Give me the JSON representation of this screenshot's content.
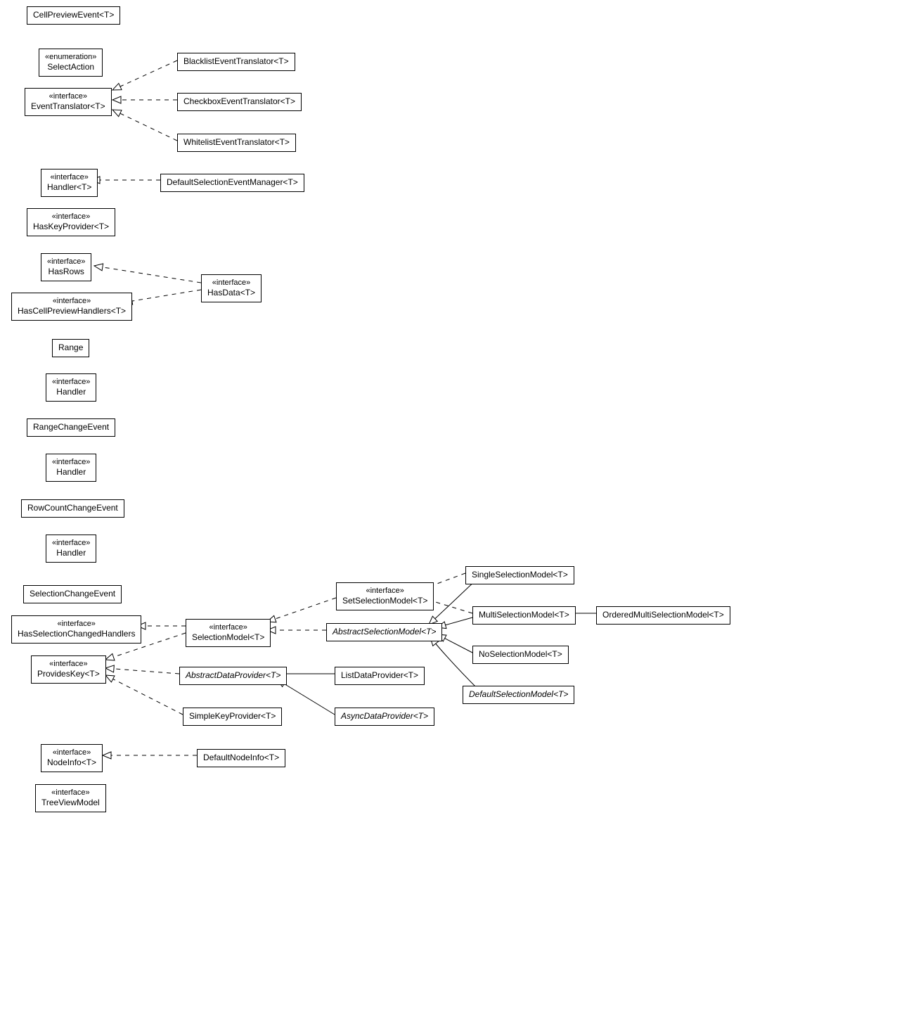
{
  "stereotypes": {
    "interface": "«interface»",
    "enumeration": "«enumeration»"
  },
  "nodes": {
    "CellPreviewEvent": "CellPreviewEvent<T>",
    "SelectAction": "SelectAction",
    "EventTranslator": "EventTranslator<T>",
    "BlacklistEventTranslator": "BlacklistEventTranslator<T>",
    "CheckboxEventTranslator": "CheckboxEventTranslator<T>",
    "WhitelistEventTranslator": "WhitelistEventTranslator<T>",
    "HandlerT": "Handler<T>",
    "DefaultSelectionEventManager": "DefaultSelectionEventManager<T>",
    "HasKeyProvider": "HasKeyProvider<T>",
    "HasRows": "HasRows",
    "HasData": "HasData<T>",
    "HasCellPreviewHandlers": "HasCellPreviewHandlers<T>",
    "Range": "Range",
    "Handler1": "Handler",
    "RangeChangeEvent": "RangeChangeEvent",
    "Handler2": "Handler",
    "RowCountChangeEvent": "RowCountChangeEvent",
    "Handler3": "Handler",
    "SelectionChangeEvent": "SelectionChangeEvent",
    "HasSelectionChangedHandlers": "HasSelectionChangedHandlers",
    "ProvidesKey": "ProvidesKey<T>",
    "SelectionModel": "SelectionModel<T>",
    "SetSelectionModel": "SetSelectionModel<T>",
    "AbstractSelectionModel": "AbstractSelectionModel<T>",
    "SingleSelectionModel": "SingleSelectionModel<T>",
    "MultiSelectionModel": "MultiSelectionModel<T>",
    "OrderedMultiSelectionModel": "OrderedMultiSelectionModel<T>",
    "NoSelectionModel": "NoSelectionModel<T>",
    "DefaultSelectionModel": "DefaultSelectionModel<T>",
    "AbstractDataProvider": "AbstractDataProvider<T>",
    "ListDataProvider": "ListDataProvider<T>",
    "AsyncDataProvider": "AsyncDataProvider<T>",
    "SimpleKeyProvider": "SimpleKeyProvider<T>",
    "NodeInfo": "NodeInfo<T>",
    "DefaultNodeInfo": "DefaultNodeInfo<T>",
    "TreeViewModel": "TreeViewModel"
  },
  "chart_data": {
    "type": "uml-class-diagram",
    "classes": [
      {
        "name": "CellPreviewEvent<T>",
        "stereotype": null
      },
      {
        "name": "SelectAction",
        "stereotype": "enumeration"
      },
      {
        "name": "EventTranslator<T>",
        "stereotype": "interface"
      },
      {
        "name": "BlacklistEventTranslator<T>",
        "stereotype": null
      },
      {
        "name": "CheckboxEventTranslator<T>",
        "stereotype": null
      },
      {
        "name": "WhitelistEventTranslator<T>",
        "stereotype": null
      },
      {
        "name": "Handler<T>",
        "stereotype": "interface"
      },
      {
        "name": "DefaultSelectionEventManager<T>",
        "stereotype": null
      },
      {
        "name": "HasKeyProvider<T>",
        "stereotype": "interface"
      },
      {
        "name": "HasRows",
        "stereotype": "interface"
      },
      {
        "name": "HasData<T>",
        "stereotype": "interface"
      },
      {
        "name": "HasCellPreviewHandlers<T>",
        "stereotype": "interface"
      },
      {
        "name": "Range",
        "stereotype": null
      },
      {
        "name": "Handler",
        "stereotype": "interface"
      },
      {
        "name": "RangeChangeEvent",
        "stereotype": null
      },
      {
        "name": "Handler",
        "stereotype": "interface"
      },
      {
        "name": "RowCountChangeEvent",
        "stereotype": null
      },
      {
        "name": "Handler",
        "stereotype": "interface"
      },
      {
        "name": "SelectionChangeEvent",
        "stereotype": null
      },
      {
        "name": "HasSelectionChangedHandlers",
        "stereotype": "interface"
      },
      {
        "name": "ProvidesKey<T>",
        "stereotype": "interface"
      },
      {
        "name": "SelectionModel<T>",
        "stereotype": "interface"
      },
      {
        "name": "SetSelectionModel<T>",
        "stereotype": "interface"
      },
      {
        "name": "AbstractSelectionModel<T>",
        "stereotype": null,
        "abstract": true
      },
      {
        "name": "SingleSelectionModel<T>",
        "stereotype": null
      },
      {
        "name": "MultiSelectionModel<T>",
        "stereotype": null
      },
      {
        "name": "OrderedMultiSelectionModel<T>",
        "stereotype": null
      },
      {
        "name": "NoSelectionModel<T>",
        "stereotype": null
      },
      {
        "name": "DefaultSelectionModel<T>",
        "stereotype": null,
        "abstract": true
      },
      {
        "name": "AbstractDataProvider<T>",
        "stereotype": null,
        "abstract": true
      },
      {
        "name": "ListDataProvider<T>",
        "stereotype": null
      },
      {
        "name": "AsyncDataProvider<T>",
        "stereotype": null,
        "abstract": true
      },
      {
        "name": "SimpleKeyProvider<T>",
        "stereotype": null
      },
      {
        "name": "NodeInfo<T>",
        "stereotype": "interface"
      },
      {
        "name": "DefaultNodeInfo<T>",
        "stereotype": null
      },
      {
        "name": "TreeViewModel",
        "stereotype": "interface"
      }
    ],
    "relationships": [
      {
        "from": "BlacklistEventTranslator<T>",
        "to": "EventTranslator<T>",
        "type": "realization"
      },
      {
        "from": "CheckboxEventTranslator<T>",
        "to": "EventTranslator<T>",
        "type": "realization"
      },
      {
        "from": "WhitelistEventTranslator<T>",
        "to": "EventTranslator<T>",
        "type": "realization"
      },
      {
        "from": "DefaultSelectionEventManager<T>",
        "to": "Handler<T>",
        "type": "realization"
      },
      {
        "from": "HasData<T>",
        "to": "HasRows",
        "type": "realization"
      },
      {
        "from": "HasData<T>",
        "to": "HasCellPreviewHandlers<T>",
        "type": "realization"
      },
      {
        "from": "SetSelectionModel<T>",
        "to": "SelectionModel<T>",
        "type": "realization"
      },
      {
        "from": "AbstractSelectionModel<T>",
        "to": "SelectionModel<T>",
        "type": "realization"
      },
      {
        "from": "SelectionModel<T>",
        "to": "HasSelectionChangedHandlers",
        "type": "realization"
      },
      {
        "from": "SelectionModel<T>",
        "to": "ProvidesKey<T>",
        "type": "realization"
      },
      {
        "from": "AbstractDataProvider<T>",
        "to": "ProvidesKey<T>",
        "type": "realization"
      },
      {
        "from": "SimpleKeyProvider<T>",
        "to": "ProvidesKey<T>",
        "type": "realization"
      },
      {
        "from": "SingleSelectionModel<T>",
        "to": "SetSelectionModel<T>",
        "type": "realization"
      },
      {
        "from": "MultiSelectionModel<T>",
        "to": "SetSelectionModel<T>",
        "type": "realization"
      },
      {
        "from": "SingleSelectionModel<T>",
        "to": "AbstractSelectionModel<T>",
        "type": "generalization"
      },
      {
        "from": "MultiSelectionModel<T>",
        "to": "AbstractSelectionModel<T>",
        "type": "generalization"
      },
      {
        "from": "NoSelectionModel<T>",
        "to": "AbstractSelectionModel<T>",
        "type": "generalization"
      },
      {
        "from": "DefaultSelectionModel<T>",
        "to": "AbstractSelectionModel<T>",
        "type": "generalization"
      },
      {
        "from": "OrderedMultiSelectionModel<T>",
        "to": "MultiSelectionModel<T>",
        "type": "generalization"
      },
      {
        "from": "ListDataProvider<T>",
        "to": "AbstractDataProvider<T>",
        "type": "generalization"
      },
      {
        "from": "AsyncDataProvider<T>",
        "to": "AbstractDataProvider<T>",
        "type": "generalization"
      },
      {
        "from": "DefaultNodeInfo<T>",
        "to": "NodeInfo<T>",
        "type": "realization"
      }
    ]
  }
}
